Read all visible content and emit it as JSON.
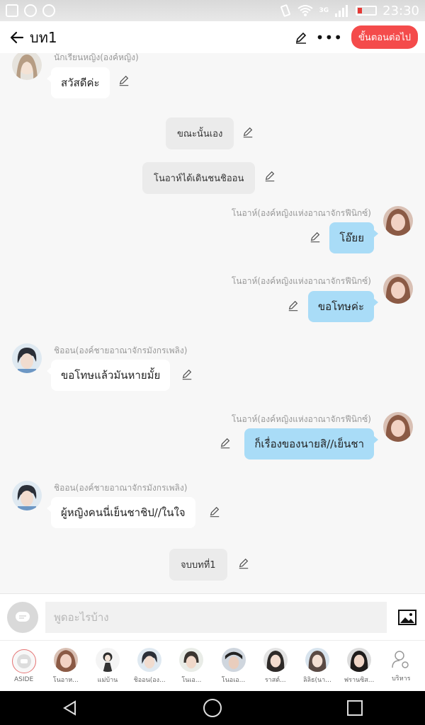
{
  "status_bar": {
    "network": "3G",
    "time": "23:30"
  },
  "header": {
    "title": "บท1",
    "next_label": "ขั้นตอนต่อไป",
    "accent": "#f44b4b"
  },
  "messages": [
    {
      "type": "left",
      "sender": "นักเรียนหญิง(องค์หญิง)",
      "text": "สวัสดีค่ะ",
      "avatar": "schoolgirl"
    },
    {
      "type": "center",
      "text": "ขณะนั้นเอง"
    },
    {
      "type": "center",
      "text": "โนอาห์ได้เดินชนชิออน"
    },
    {
      "type": "right",
      "sender": "โนอาห์(องค์หญิงแห่งอาณาจักรฟีนิกซ์)",
      "text": "โอ๊ยย",
      "avatar": "noah"
    },
    {
      "type": "right",
      "sender": "โนอาห์(องค์หญิงแห่งอาณาจักรฟีนิกซ์)",
      "text": "ขอโทษค่ะ",
      "avatar": "noah"
    },
    {
      "type": "left",
      "sender": "ชิออน(องค์ชายอาณาจักรมังกรเพลิง)",
      "text": "ขอโทษแล้วมันหายมั้ย",
      "avatar": "shion"
    },
    {
      "type": "right",
      "sender": "โนอาห์(องค์หญิงแห่งอาณาจักรฟีนิกซ์)",
      "text": "ก็เรื่องของนายสิ//เย็นชา",
      "avatar": "noah"
    },
    {
      "type": "left",
      "sender": "ชิออน(องค์ชายอาณาจักรมังกรเพลิง)",
      "text": "ผู้หญิงคนนี่เย็นชาชิป//ในใจ",
      "avatar": "shion"
    },
    {
      "type": "center",
      "text": "จบบทที่1"
    }
  ],
  "input": {
    "placeholder": "พูดอะไรบ้าง"
  },
  "characters": [
    {
      "label": "ASIDE"
    },
    {
      "label": "โนอาห..."
    },
    {
      "label": "แม่บ้าน"
    },
    {
      "label": "ชิออน(อง..."
    },
    {
      "label": "โนเอ..."
    },
    {
      "label": "โนอเอ..."
    },
    {
      "label": "ราสต์..."
    },
    {
      "label": "ลิลิธ(นา..."
    },
    {
      "label": "ฟรานซิส..."
    },
    {
      "label": "บริหาร"
    }
  ],
  "colors": {
    "bubble_right": "#a9dcf7",
    "bubble_left": "#ffffff",
    "system_bubble": "#ebebeb"
  }
}
